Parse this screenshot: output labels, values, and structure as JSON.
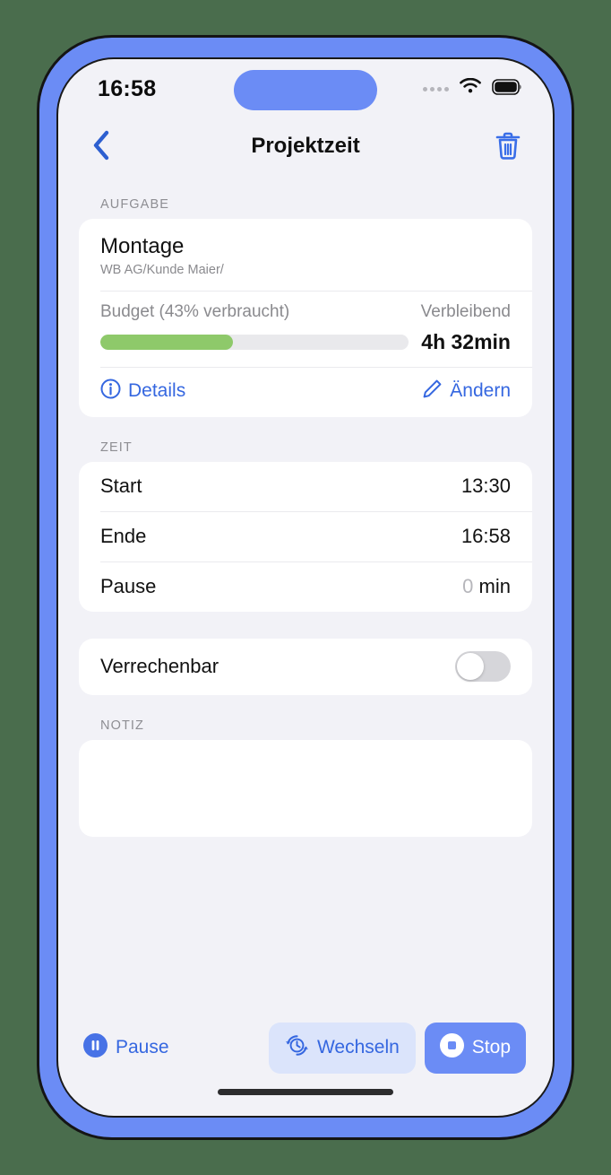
{
  "status_bar": {
    "time": "16:58",
    "signal_icon": "signal-dots-icon",
    "wifi_icon": "wifi-icon",
    "battery_icon": "battery-full-icon"
  },
  "nav": {
    "back_icon": "chevron-left-icon",
    "title": "Projektzeit",
    "delete_icon": "trash-icon"
  },
  "sections": {
    "task_label": "AUFGABE",
    "time_label": "ZEIT",
    "note_label": "NOTIZ"
  },
  "task": {
    "title": "Montage",
    "subtitle": "WB AG/Kunde Maier/",
    "budget_text": "Budget (43% verbraucht)",
    "budget_percent": 43,
    "remaining_label": "Verbleibend",
    "remaining_value": "4h 32min",
    "details_label": "Details",
    "details_icon": "info-circle-icon",
    "edit_label": "Ändern",
    "edit_icon": "pencil-icon",
    "progress_color": "#8ec96a"
  },
  "time_rows": [
    {
      "label": "Start",
      "value": "13:30"
    },
    {
      "label": "Ende",
      "value": "16:58"
    }
  ],
  "pause_row": {
    "label": "Pause",
    "value": "0",
    "unit": "min"
  },
  "billable": {
    "label": "Verrechenbar",
    "enabled": false
  },
  "note": {
    "value": "",
    "placeholder": ""
  },
  "bottom_bar": {
    "pause_label": "Pause",
    "pause_icon": "pause-circle-icon",
    "switch_label": "Wechseln",
    "switch_icon": "switch-clock-icon",
    "stop_label": "Stop",
    "stop_icon": "stop-circle-icon"
  },
  "theme": {
    "accent_blue": "#3567e0",
    "frame_blue": "#6b8cf5",
    "page_background": "#4a6d4d",
    "screen_background": "#f2f2f7"
  }
}
